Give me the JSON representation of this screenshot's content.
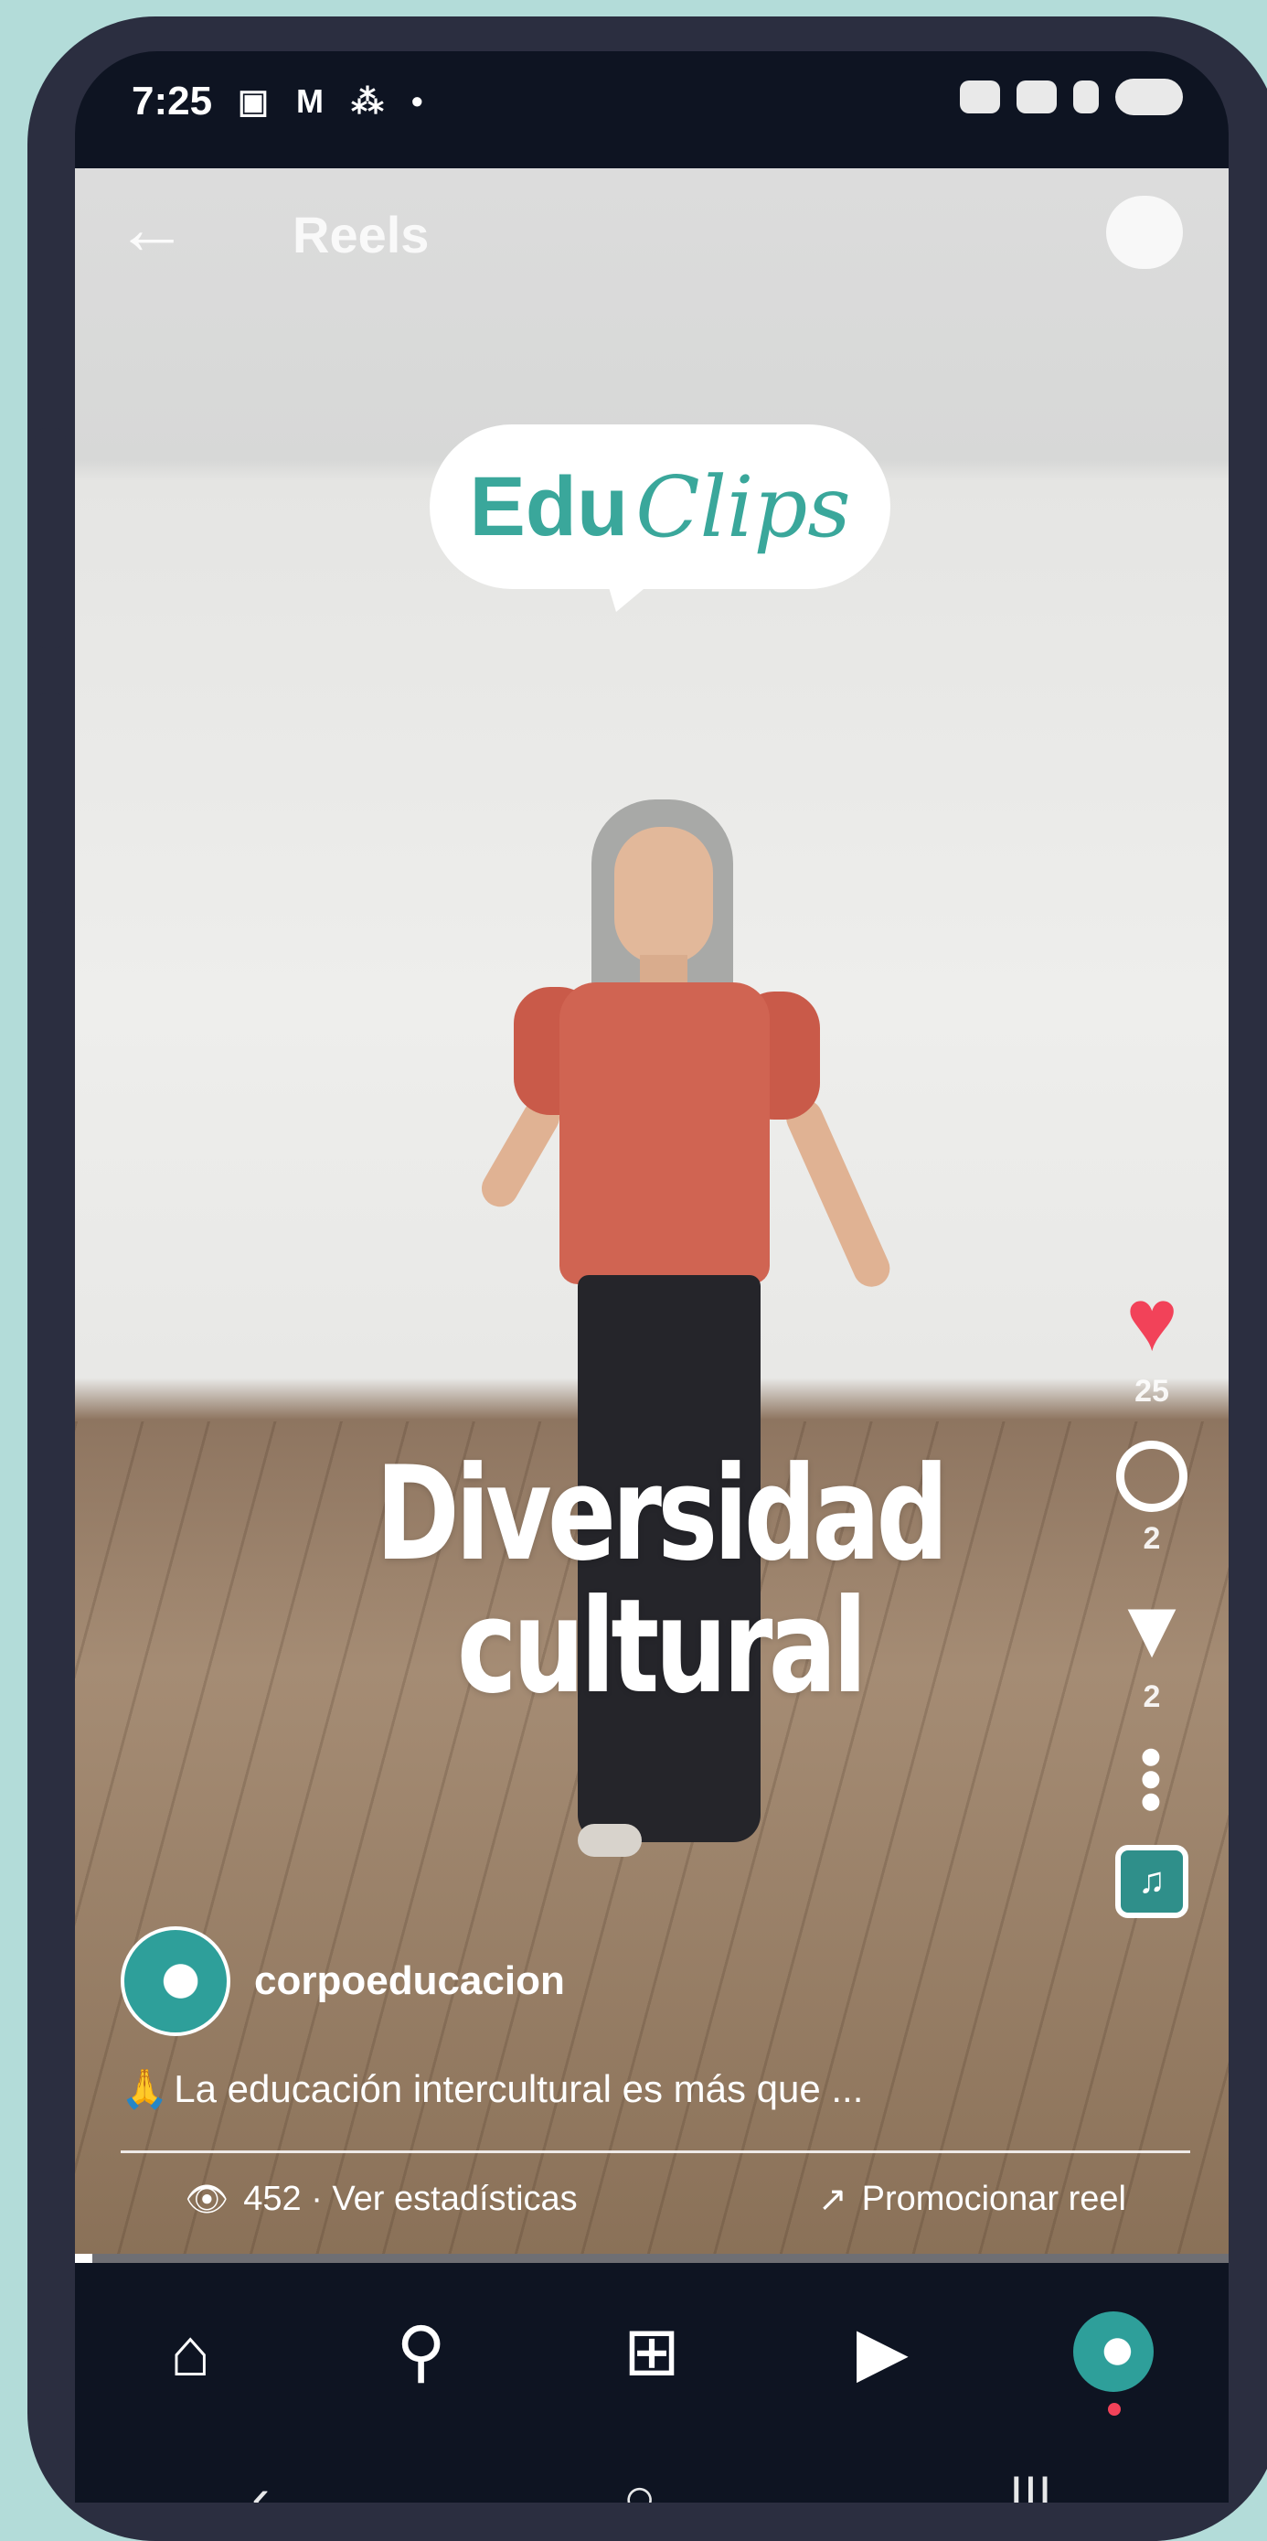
{
  "status_bar": {
    "time": "7:25",
    "left_icons": "▣ M ⁂ •"
  },
  "header": {
    "back_icon": "←",
    "title": "Reels",
    "camera_icon": "camera-icon"
  },
  "video": {
    "logo_part1": "Edu",
    "logo_part2": "Clips",
    "overlay_title": "Diversidad cultural"
  },
  "actions": {
    "like_count": "25",
    "comment_count": "2",
    "share_count": "2"
  },
  "post": {
    "username": "corpoeducacion",
    "caption_emoji": "🙏",
    "caption": "La educación intercultural es más que ...",
    "views": "452 · Ver estadísticas",
    "promote": "Promocionar reel"
  },
  "progress": {
    "fraction": 0.015
  },
  "tabs": [
    "home",
    "search",
    "create",
    "reels",
    "profile"
  ],
  "colors": {
    "accent": "#2e9f9a",
    "like": "#f24259",
    "frame": "#2b2e40",
    "background": "#b3dcd9"
  }
}
